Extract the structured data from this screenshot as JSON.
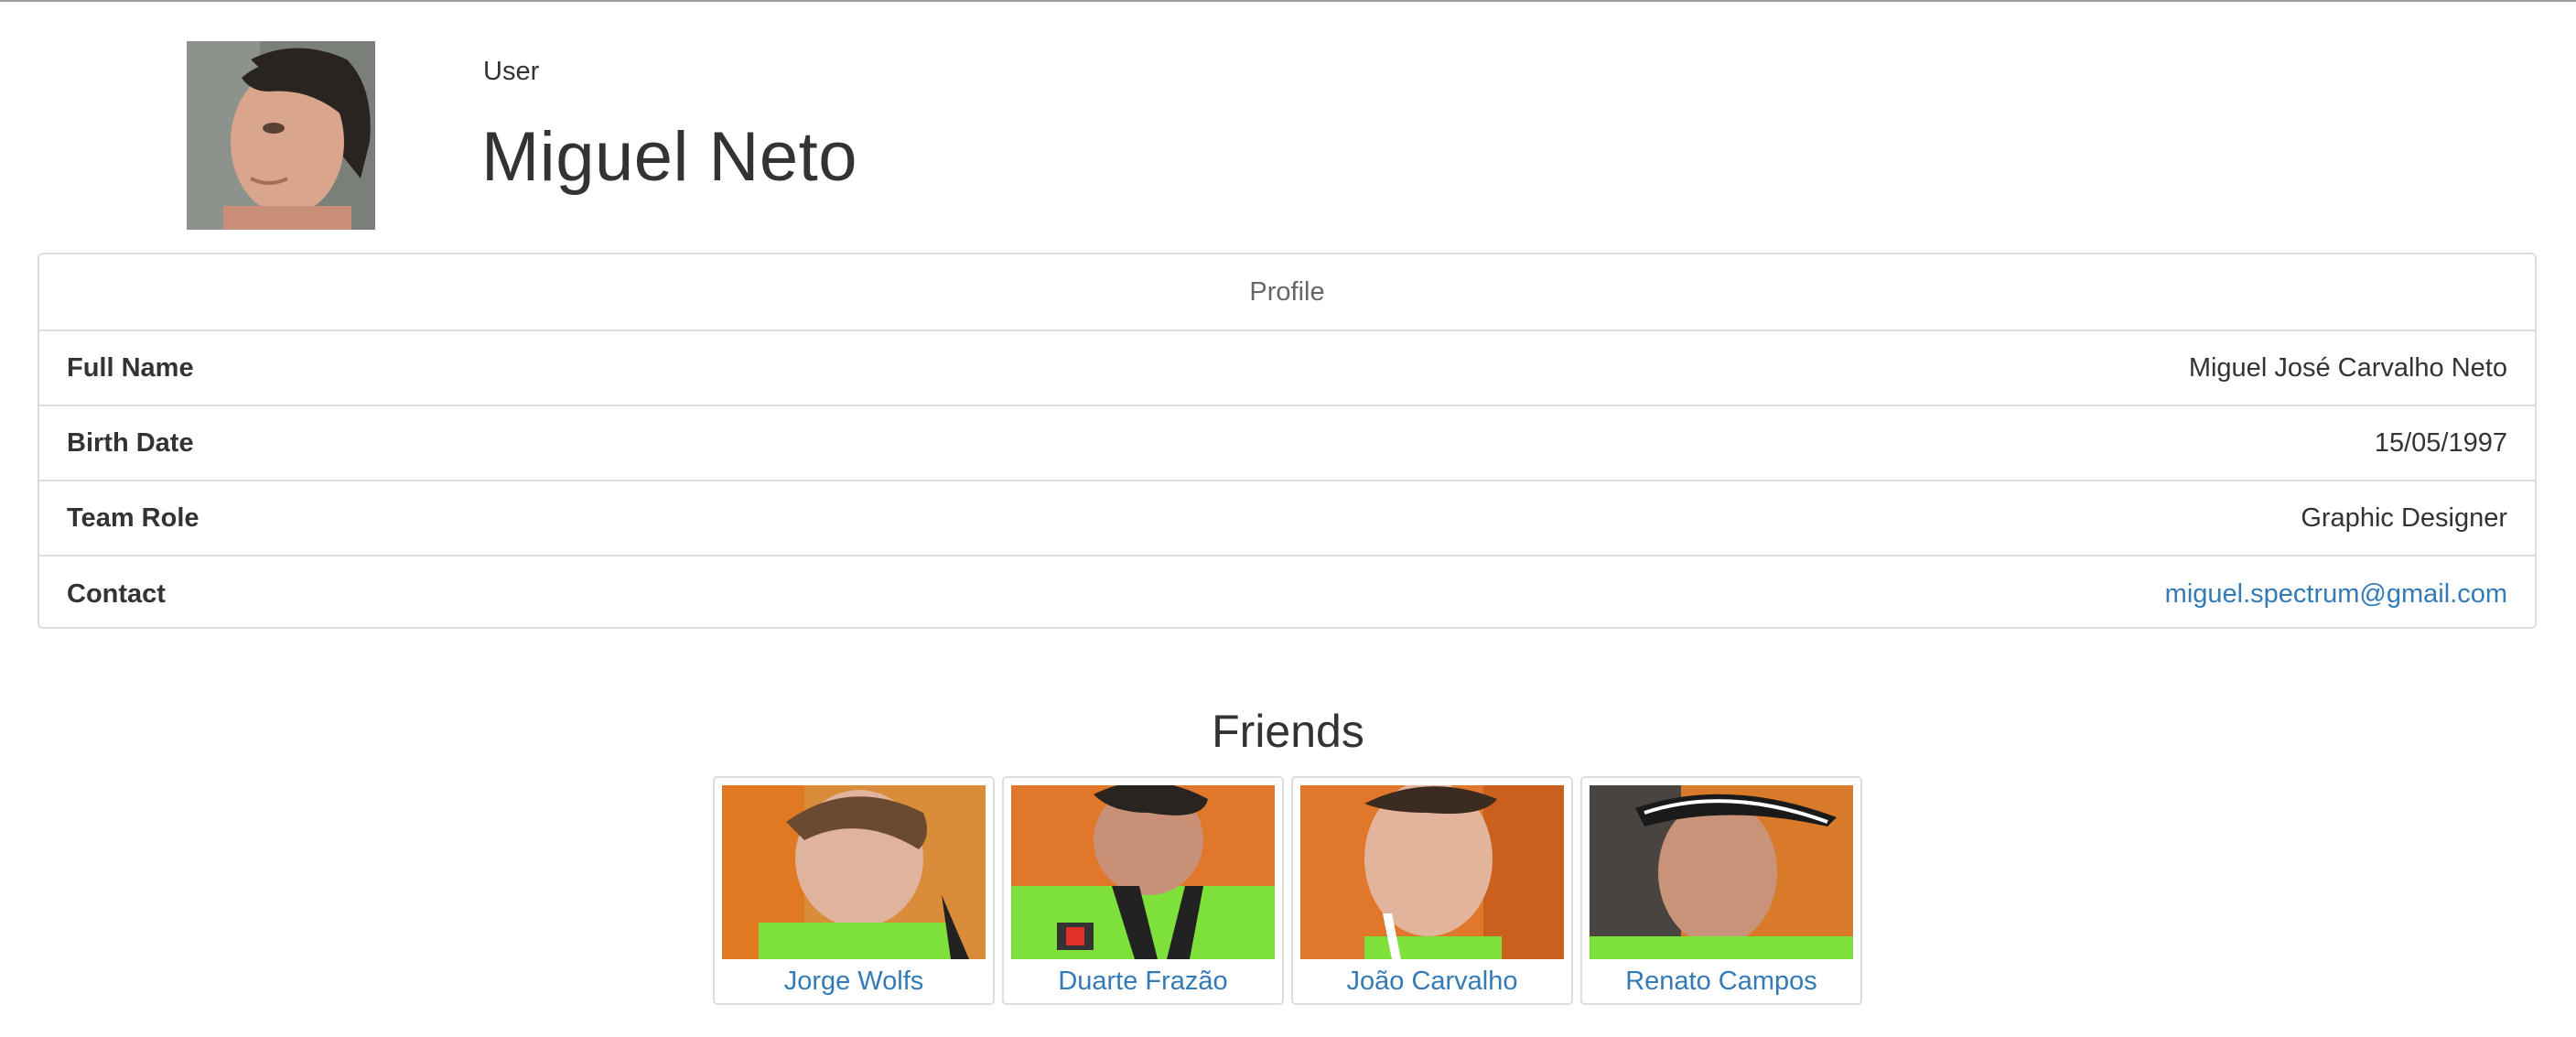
{
  "header": {
    "role_label": "User",
    "user_name": "Miguel Neto"
  },
  "profile": {
    "heading": "Profile",
    "rows": [
      {
        "label": "Full Name",
        "value": "Miguel José Carvalho Neto"
      },
      {
        "label": "Birth Date",
        "value": "15/05/1997"
      },
      {
        "label": "Team Role",
        "value": "Graphic Designer"
      },
      {
        "label": "Contact",
        "value": "miguel.spectrum@gmail.com"
      }
    ]
  },
  "friends": {
    "title": "Friends",
    "items": [
      {
        "name": "Jorge Wolfs"
      },
      {
        "name": "Duarte Frazão"
      },
      {
        "name": "João Carvalho"
      },
      {
        "name": "Renato Campos"
      }
    ]
  },
  "colors": {
    "link": "#337ab7",
    "border": "#dddddd",
    "text": "#333333"
  }
}
